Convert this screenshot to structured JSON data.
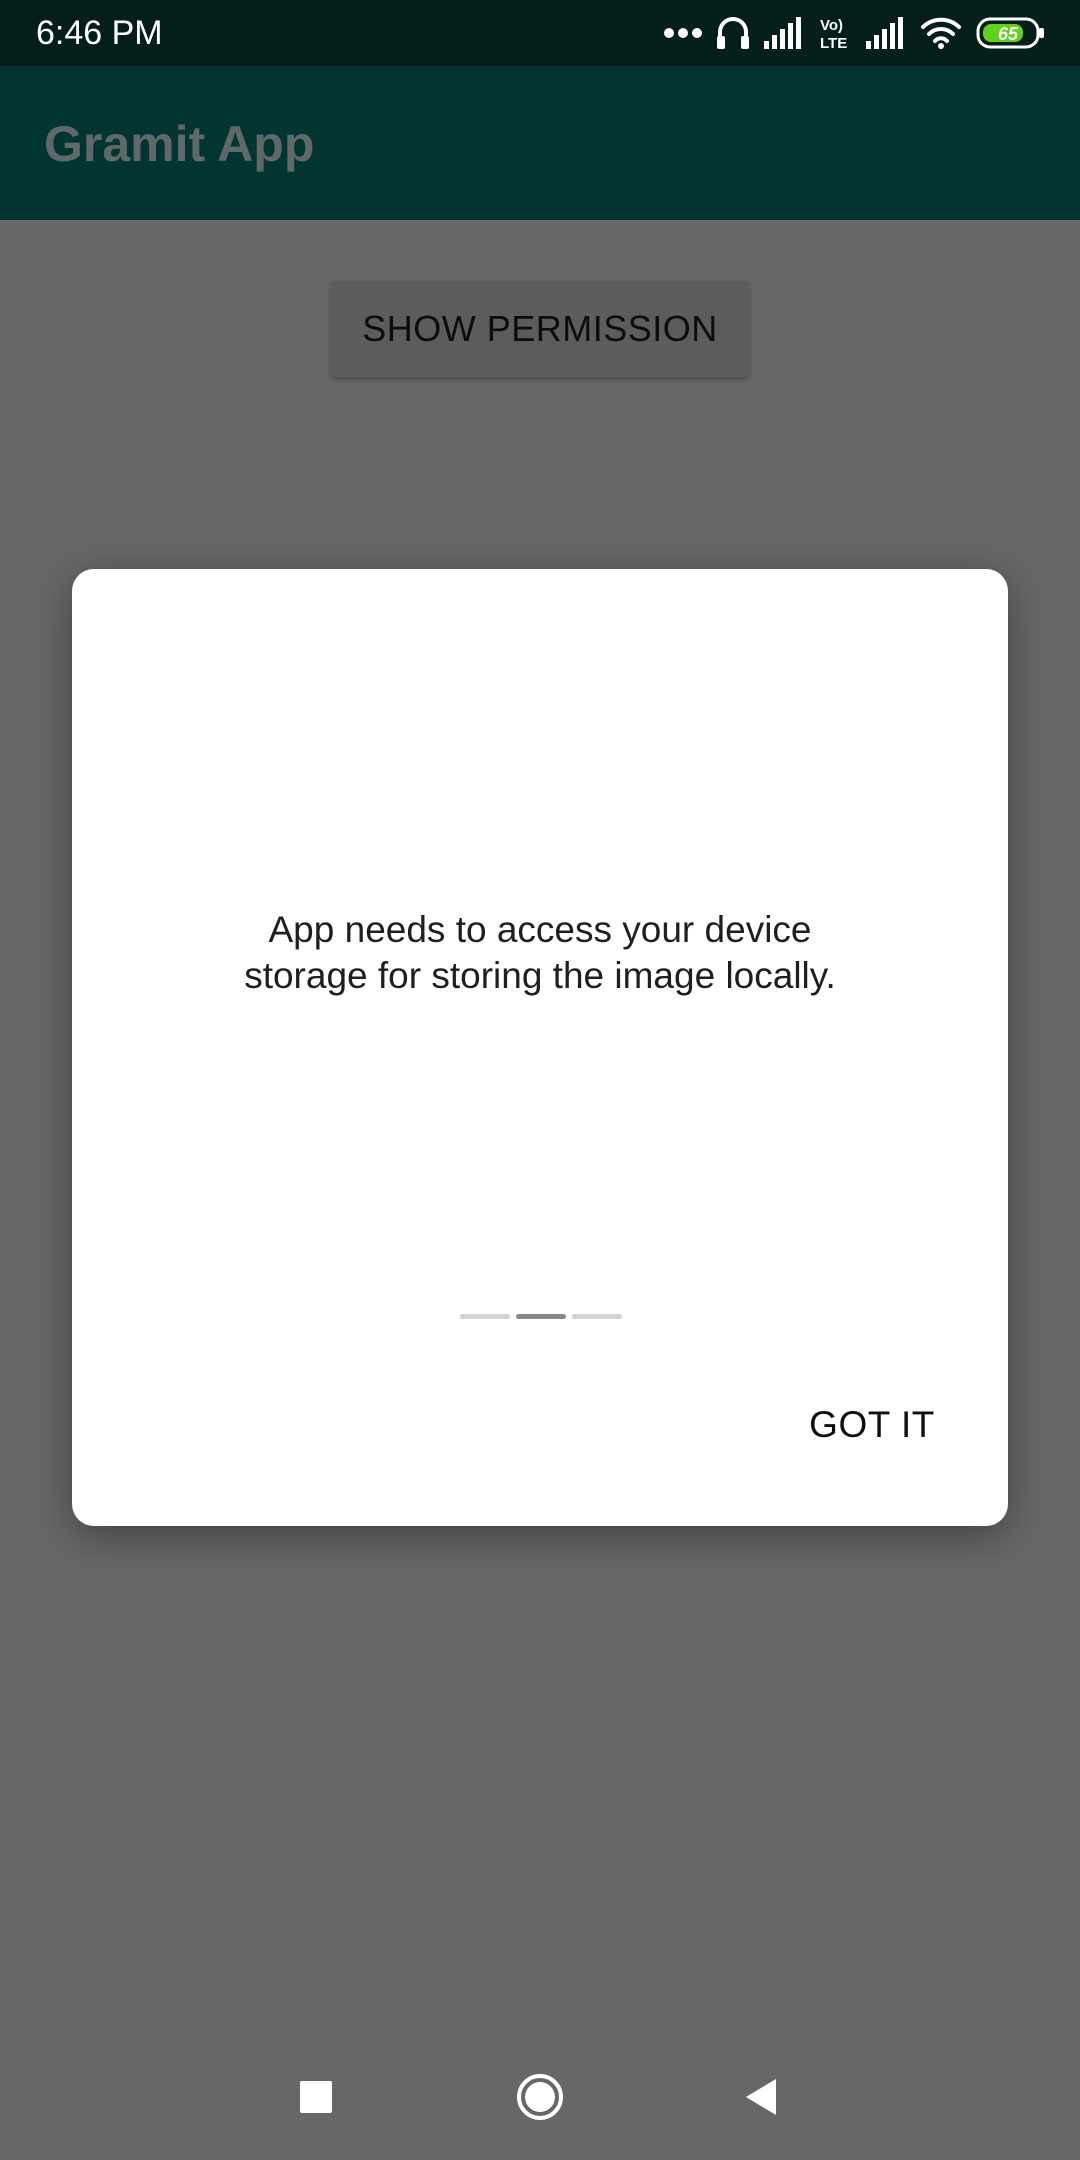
{
  "status_bar": {
    "time": "6:46 PM",
    "battery_level": "65",
    "icons": [
      "more-dots-icon",
      "headset-icon",
      "signal-icon",
      "volte-icon",
      "signal-icon",
      "wifi-icon",
      "battery-icon"
    ]
  },
  "app_bar": {
    "title": "Gramit App"
  },
  "main": {
    "show_permission_label": "SHOW PERMISSION"
  },
  "dialog": {
    "message": "App needs to access your device\nstorage for storing the image locally.",
    "pager": {
      "total": 3,
      "active_index": 1
    },
    "got_it_label": "GOT IT"
  },
  "nav_bar": {
    "icons": [
      "recents-icon",
      "home-icon",
      "back-icon"
    ]
  },
  "colors": {
    "status_bar": "#031e1b",
    "app_bar": "#033530",
    "scrim_background": "#676767",
    "dialog": "#ffffff",
    "battery_fill": "#5fd21b"
  }
}
